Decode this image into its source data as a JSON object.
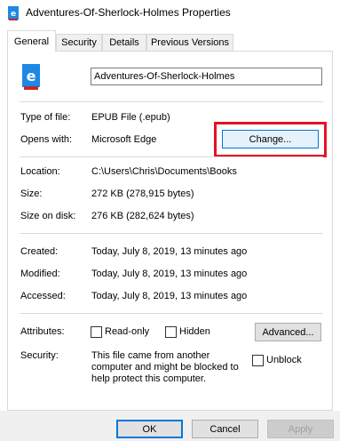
{
  "window": {
    "title": "Adventures-Of-Sherlock-Holmes Properties",
    "icon": "epub-file-icon"
  },
  "tabs": [
    {
      "label": "General",
      "active": true
    },
    {
      "label": "Security",
      "active": false
    },
    {
      "label": "Details",
      "active": false
    },
    {
      "label": "Previous Versions",
      "active": false
    }
  ],
  "general": {
    "filename": "Adventures-Of-Sherlock-Holmes",
    "type_label": "Type of file:",
    "type_value": "EPUB File (.epub)",
    "opens_label": "Opens with:",
    "opens_value": "Microsoft Edge",
    "change_button": "Change...",
    "location_label": "Location:",
    "location_value": "C:\\Users\\Chris\\Documents\\Books",
    "size_label": "Size:",
    "size_value": "272 KB (278,915 bytes)",
    "size_on_disk_label": "Size on disk:",
    "size_on_disk_value": "276 KB (282,624 bytes)",
    "created_label": "Created:",
    "created_value": "Today, July 8, 2019, 13 minutes ago",
    "modified_label": "Modified:",
    "modified_value": "Today, July 8, 2019, 13 minutes ago",
    "accessed_label": "Accessed:",
    "accessed_value": "Today, July 8, 2019, 13 minutes ago",
    "attributes_label": "Attributes:",
    "readonly_label": "Read-only",
    "readonly_checked": false,
    "hidden_label": "Hidden",
    "hidden_checked": false,
    "advanced_button": "Advanced...",
    "security_label": "Security:",
    "security_text": "This file came from another computer and might be blocked to help protect this computer.",
    "unblock_label": "Unblock",
    "unblock_checked": false
  },
  "footer": {
    "ok": "OK",
    "cancel": "Cancel",
    "apply": "Apply"
  },
  "colors": {
    "accent": "#0078d7",
    "highlight": "#e81123",
    "edge_blue": "#1e88e5"
  }
}
